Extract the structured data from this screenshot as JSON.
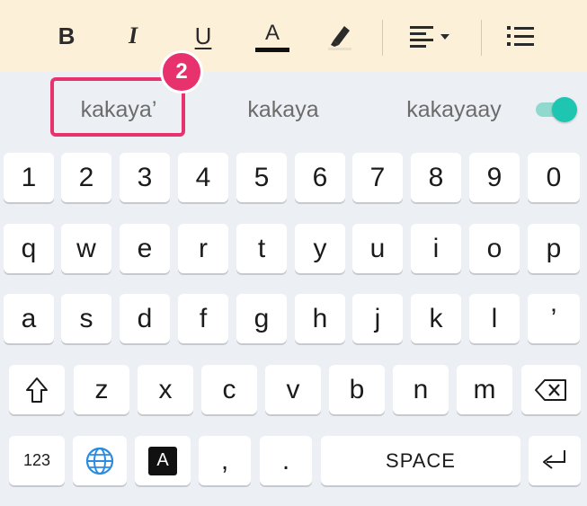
{
  "toolbar": {
    "bold": "B",
    "italic": "I",
    "underline": "U",
    "font_color": "A",
    "icons": [
      "bold-icon",
      "italic-icon",
      "underline-icon",
      "font-color-icon",
      "highlighter-icon",
      "align-dropdown-icon",
      "bulleted-list-icon"
    ]
  },
  "suggestions": {
    "items": [
      "kakaya’",
      "kakaya",
      "kakayaay"
    ],
    "toggle_on": true
  },
  "annotation": {
    "badge": "2",
    "color": "#e8326e"
  },
  "keyboard": {
    "row_numbers": [
      "1",
      "2",
      "3",
      "4",
      "5",
      "6",
      "7",
      "8",
      "9",
      "0"
    ],
    "row_top": [
      "q",
      "w",
      "e",
      "r",
      "t",
      "y",
      "u",
      "i",
      "o",
      "p"
    ],
    "row_home": [
      "a",
      "s",
      "d",
      "f",
      "g",
      "h",
      "j",
      "k",
      "l",
      "’"
    ],
    "row_bottom": [
      "z",
      "x",
      "c",
      "v",
      "b",
      "n",
      "m"
    ],
    "numbers_key": "123",
    "lang_key_letter": "A",
    "comma": ",",
    "period": ".",
    "space": "SPACE"
  },
  "colors": {
    "toolbar_bg": "#fdf0d9",
    "keyboard_bg": "#eceff3",
    "accent": "#1ec6b1"
  }
}
